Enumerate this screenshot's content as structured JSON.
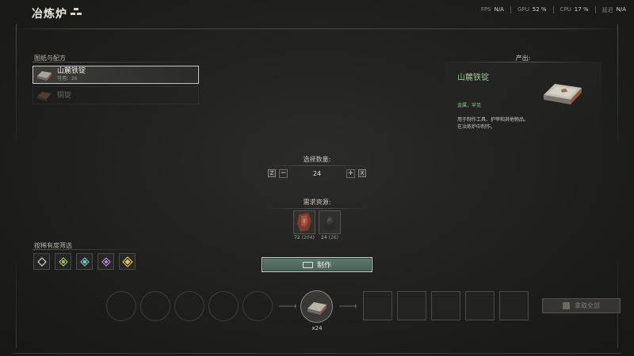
{
  "header": {
    "title": "冶炼炉",
    "title_icon": "ingot-stack-icon"
  },
  "stats": [
    {
      "label": "FPS",
      "value": "N/A"
    },
    {
      "label": "GPU",
      "value": "52",
      "unit": "%"
    },
    {
      "label": "CPU",
      "value": "17",
      "unit": "%"
    },
    {
      "label": "延迟",
      "value": "N/A"
    }
  ],
  "recipes": {
    "heading": "图纸与配方",
    "items": [
      {
        "name": "山麓铁锭",
        "sub": "可用：26",
        "active": true
      },
      {
        "name": "铜锭",
        "sub": "",
        "active": false
      }
    ]
  },
  "filters": {
    "heading": "按稀有度筛选",
    "colors": [
      "#d8d4c8",
      "#a7c96a",
      "#6fc4c0",
      "#b58be0",
      "#d9c85a"
    ]
  },
  "quantity": {
    "heading": "选择数量:",
    "dec_key": "Z",
    "inc_key": "X",
    "minus": "−",
    "plus": "+",
    "value": "24"
  },
  "resources": {
    "heading": "需求资源:",
    "items": [
      {
        "need": "72",
        "have": "(204)",
        "icon": "iron-ore-icon"
      },
      {
        "need": "24",
        "have": "(26)",
        "icon": "coal-icon"
      }
    ]
  },
  "craft": {
    "label": "制作"
  },
  "queue": {
    "count_label": "x24"
  },
  "take_all": {
    "label": "拿取全部"
  },
  "output": {
    "heading": "产出:",
    "name": "山麓铁锭",
    "tags": "金属，罕见",
    "desc_line1": "用于制作工具、护甲和其他物品。",
    "desc_line2": "在冶炼炉中制作。"
  }
}
